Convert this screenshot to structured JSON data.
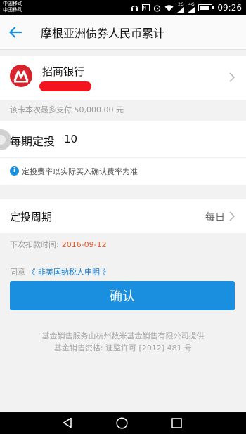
{
  "status_bar": {
    "carrier_1": "中国移动",
    "carrier_2": "中国移动",
    "network_1": "2G",
    "network_2": "4G",
    "time": "09:26"
  },
  "header": {
    "title": "摩根亚洲债券人民币累计"
  },
  "bank": {
    "name": "招商银行",
    "limit_text": "该卡本次最多支付 50,000.00 元"
  },
  "amount": {
    "label": "每期定投",
    "value": "10",
    "note": "定投费率以实际买入确认费率为准"
  },
  "period": {
    "label": "定投周期",
    "value": "每日",
    "next_label": "下次扣款时间:",
    "next_date": "2016-09-12"
  },
  "agreement": {
    "prefix": "同意",
    "link": "《 非美国纳税人申明 》"
  },
  "confirm_label": "确认",
  "footer": {
    "line1": "基金销售服务由杭州数米基金销售有限公司提供",
    "line2": "基金销售资格: 证监许可 [2012] 481 号"
  },
  "colors": {
    "accent": "#1a8fe0",
    "date": "#e0582a",
    "bank": "#d9232c"
  }
}
